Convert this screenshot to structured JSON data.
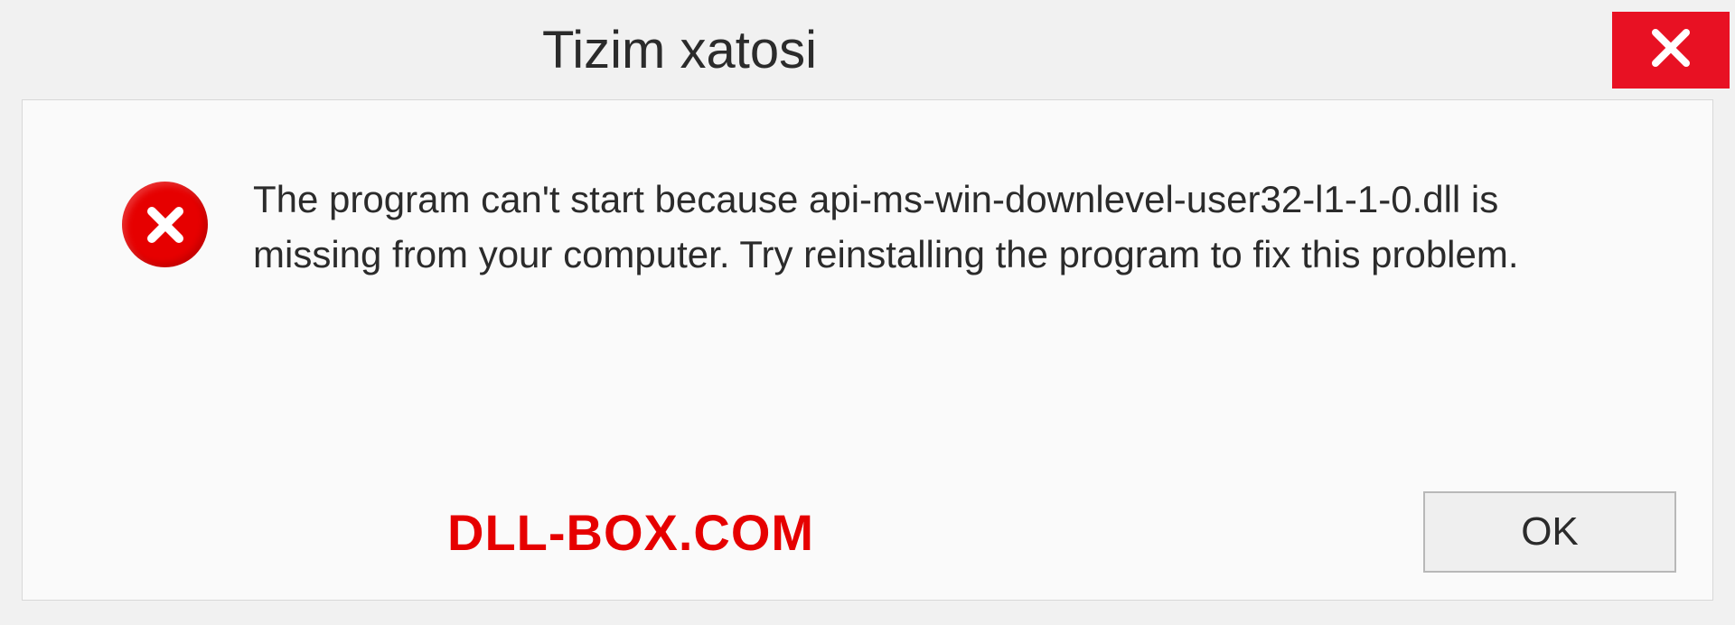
{
  "dialog": {
    "title": "Tizim xatosi",
    "message": "The program can't start because api-ms-win-downlevel-user32-l1-1-0.dll is missing from your computer. Try reinstalling the program to fix this problem.",
    "ok_label": "OK",
    "watermark": "DLL-BOX.COM"
  }
}
